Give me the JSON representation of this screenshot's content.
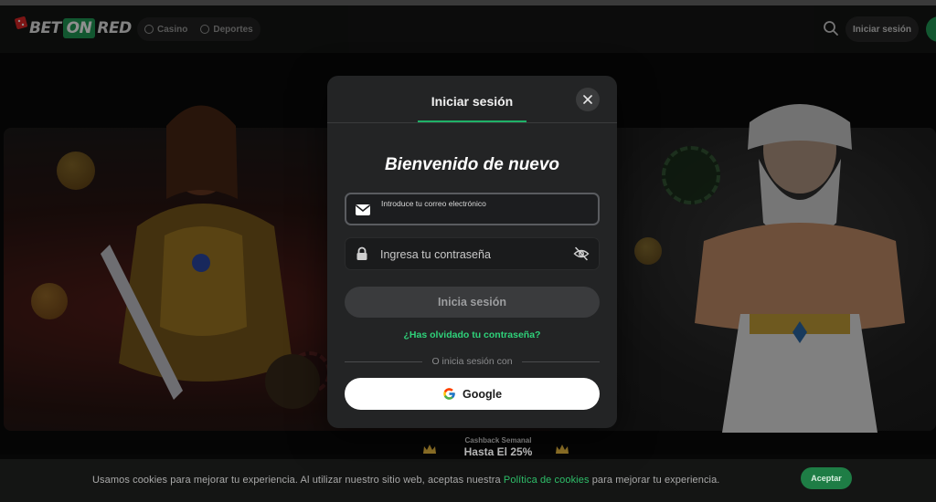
{
  "header": {
    "logo": {
      "part1": "BET",
      "part2": "ON",
      "part3": "RED"
    },
    "nav": [
      {
        "label": "Casino",
        "icon": "casino-icon"
      },
      {
        "label": "Deportes",
        "icon": "sports-ball-icon"
      }
    ],
    "login_label": "Iniciar sesión"
  },
  "modal": {
    "tab_label": "Iniciar sesión",
    "welcome": "Bienvenido de nuevo",
    "email": {
      "label": "Introduce tu correo electrónico",
      "value": ""
    },
    "password": {
      "placeholder": "Ingresa tu contraseña",
      "value": ""
    },
    "submit_label": "Inicia sesión",
    "forgot_label": "¿Has olvidado tu contraseña?",
    "divider_label": "O inicia sesión con",
    "google_label": "Google"
  },
  "promo": {
    "small": "Cashback Semanal",
    "big": "Hasta El 25%"
  },
  "cookies": {
    "text_before": "Usamos cookies para mejorar tu experiencia. Al utilizar nuestro sitio web, aceptas nuestra ",
    "link": "Política de cookies",
    "text_after": " para mejorar tu experiencia.",
    "accept_label": "Aceptar"
  },
  "colors": {
    "accent": "#1fb268",
    "brand_green": "#1c9a52",
    "modal_bg": "#232425",
    "page_bg": "#0d0d0d"
  }
}
